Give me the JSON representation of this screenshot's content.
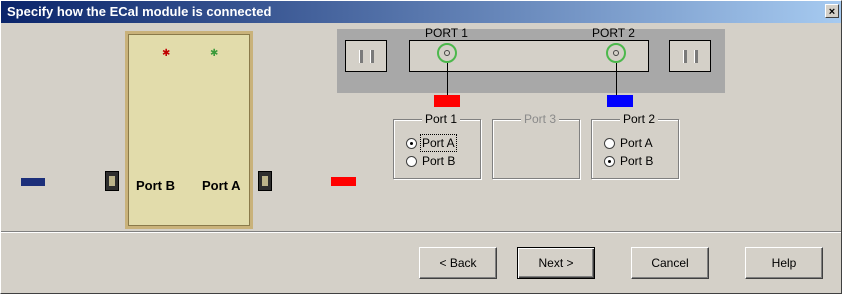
{
  "window": {
    "title": "Specify how the ECal module is connected"
  },
  "module": {
    "port_b_label": "Port B",
    "port_a_label": "Port A"
  },
  "analyzer": {
    "port1_label": "PORT 1",
    "port2_label": "PORT 2"
  },
  "groups": {
    "port1": {
      "title": "Port 1",
      "options": [
        "Port A",
        "Port B"
      ],
      "selected": "Port A"
    },
    "port3": {
      "title": "Port 3",
      "enabled": false
    },
    "port2": {
      "title": "Port 2",
      "options": [
        "Port A",
        "Port B"
      ],
      "selected": "Port B"
    }
  },
  "buttons": {
    "back": "< Back",
    "next": "Next >",
    "cancel": "Cancel",
    "help": "Help"
  },
  "colors": {
    "port1_cable": "#ff0000",
    "port2_cable": "#0000ff",
    "module_b_cable": "#1c2f7a",
    "led_red": "#c00000",
    "led_green": "#3a9a3a",
    "port_ring": "#4cb84c"
  },
  "icons": {
    "close": "close-icon",
    "connector": "connector-icon"
  }
}
